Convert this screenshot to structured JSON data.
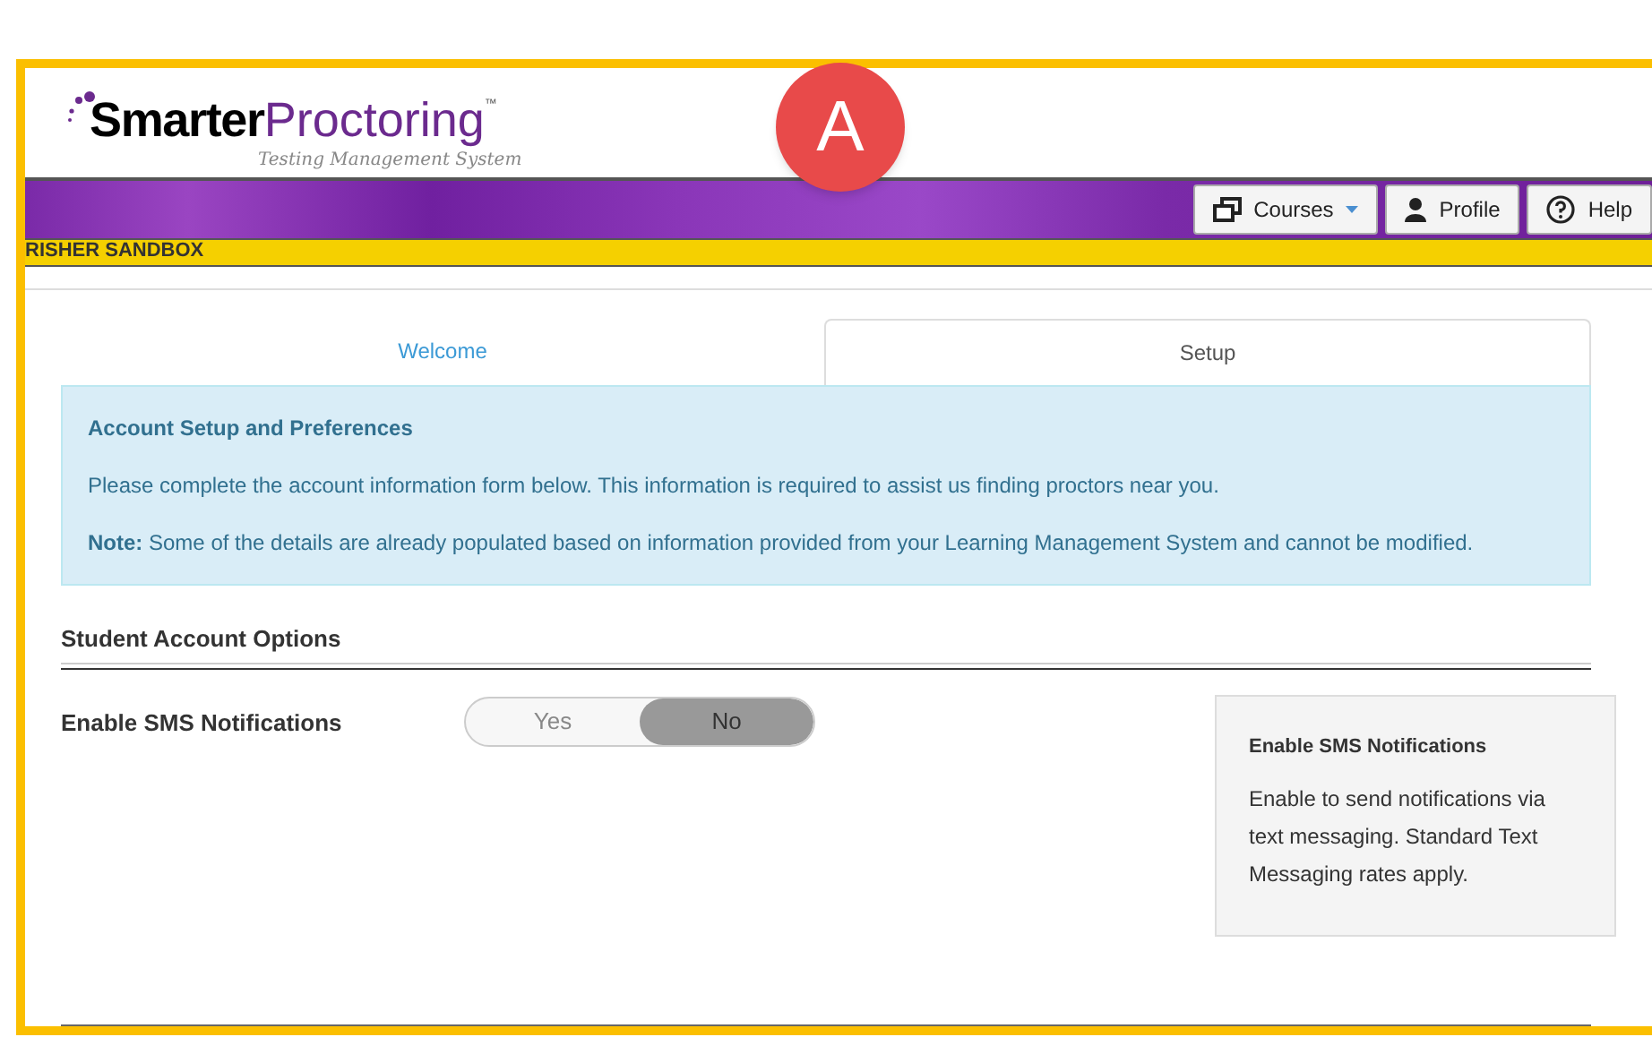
{
  "marker": {
    "label": "A"
  },
  "logo": {
    "word_1": "Smarter",
    "word_2": "Proctoring",
    "trademark": "™",
    "tagline": "Testing Management System"
  },
  "nav_buttons": [
    {
      "kind": "courses",
      "label": "Courses"
    },
    {
      "kind": "profile",
      "label": "Profile"
    },
    {
      "kind": "help",
      "label": "Help"
    }
  ],
  "banner": {
    "text": "RISHER SANDBOX"
  },
  "tabs": [
    {
      "label": "Welcome",
      "selected": false
    },
    {
      "label": "Setup",
      "selected": true
    }
  ],
  "info": {
    "title": "Account Setup and Preferences",
    "paragraphs": [
      "Please complete the account information form below. This information is required to assist us finding proctors near you.",
      "**Note:** Some of the details are already populated based on information provided from your Learning Management System and cannot be modified."
    ]
  },
  "section": {
    "title": "Student Account Options"
  },
  "setting": {
    "label": "Enable SMS Notifications",
    "options": [
      {
        "label": "Yes",
        "selected": false
      },
      {
        "label": "No",
        "selected": true
      }
    ]
  },
  "help_box": {
    "title": "Enable SMS Notifications",
    "text": "Enable to send notifications via text messaging. Standard Text Messaging rates apply."
  }
}
